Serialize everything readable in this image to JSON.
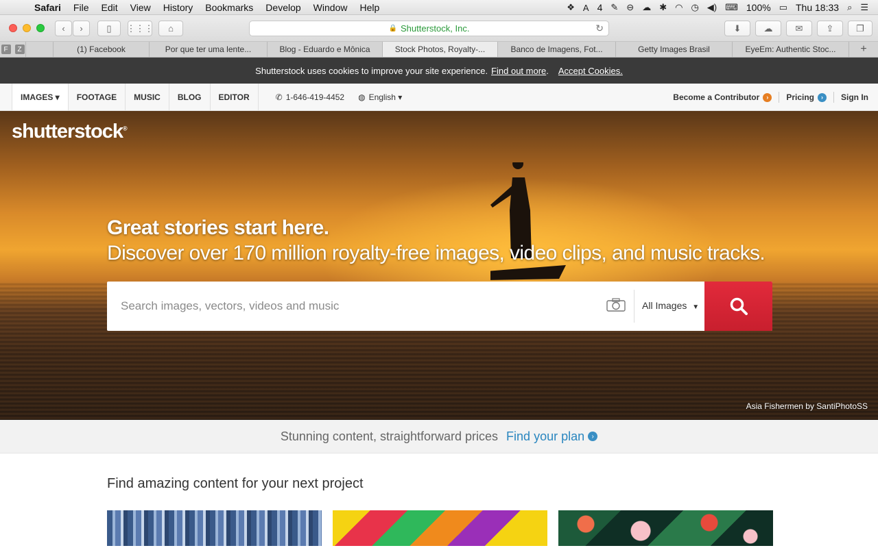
{
  "menubar": {
    "app": "Safari",
    "items": [
      "File",
      "Edit",
      "View",
      "History",
      "Bookmarks",
      "Develop",
      "Window",
      "Help"
    ],
    "status": {
      "adobe_count": "4",
      "battery": "100%",
      "clock": "Thu 18:33"
    }
  },
  "browser": {
    "address": "Shutterstock, Inc.",
    "pinned": [
      "F",
      "Z"
    ],
    "tabs": [
      "(1) Facebook",
      "Por que ter uma lente...",
      "Blog - Eduardo e Mônica",
      "Stock Photos, Royalty-...",
      "Banco de Imagens, Fot...",
      "Getty Images Brasil",
      "EyeEm: Authentic Stoc..."
    ],
    "active_tab_index": 3
  },
  "cookie": {
    "message": "Shutterstock uses cookies to improve your site experience.",
    "find_out": "Find out more",
    "period": ".",
    "accept": "Accept Cookies."
  },
  "nav": {
    "tabs": [
      "IMAGES ▾",
      "FOOTAGE",
      "MUSIC",
      "BLOG",
      "EDITOR"
    ],
    "phone": "1-646-419-4452",
    "language": "English ▾",
    "contributor": "Become a Contributor",
    "pricing": "Pricing",
    "signin": "Sign In"
  },
  "hero": {
    "logo": "shutterstock",
    "headline_1": "Great stories start here.",
    "headline_2": "Discover over 170 million royalty-free images, video clips, and music tracks.",
    "search_placeholder": "Search images, vectors, videos and music",
    "filter": "All Images",
    "credit": "Asia Fishermen by SantiPhotoSS"
  },
  "plan": {
    "text": "Stunning content, straightforward prices",
    "link": "Find your plan"
  },
  "section": {
    "title": "Find amazing content for your next project"
  },
  "colors": {
    "accent_red": "#d9252f",
    "link_blue": "#2a86bf",
    "contributor_orange": "#e67e22"
  }
}
